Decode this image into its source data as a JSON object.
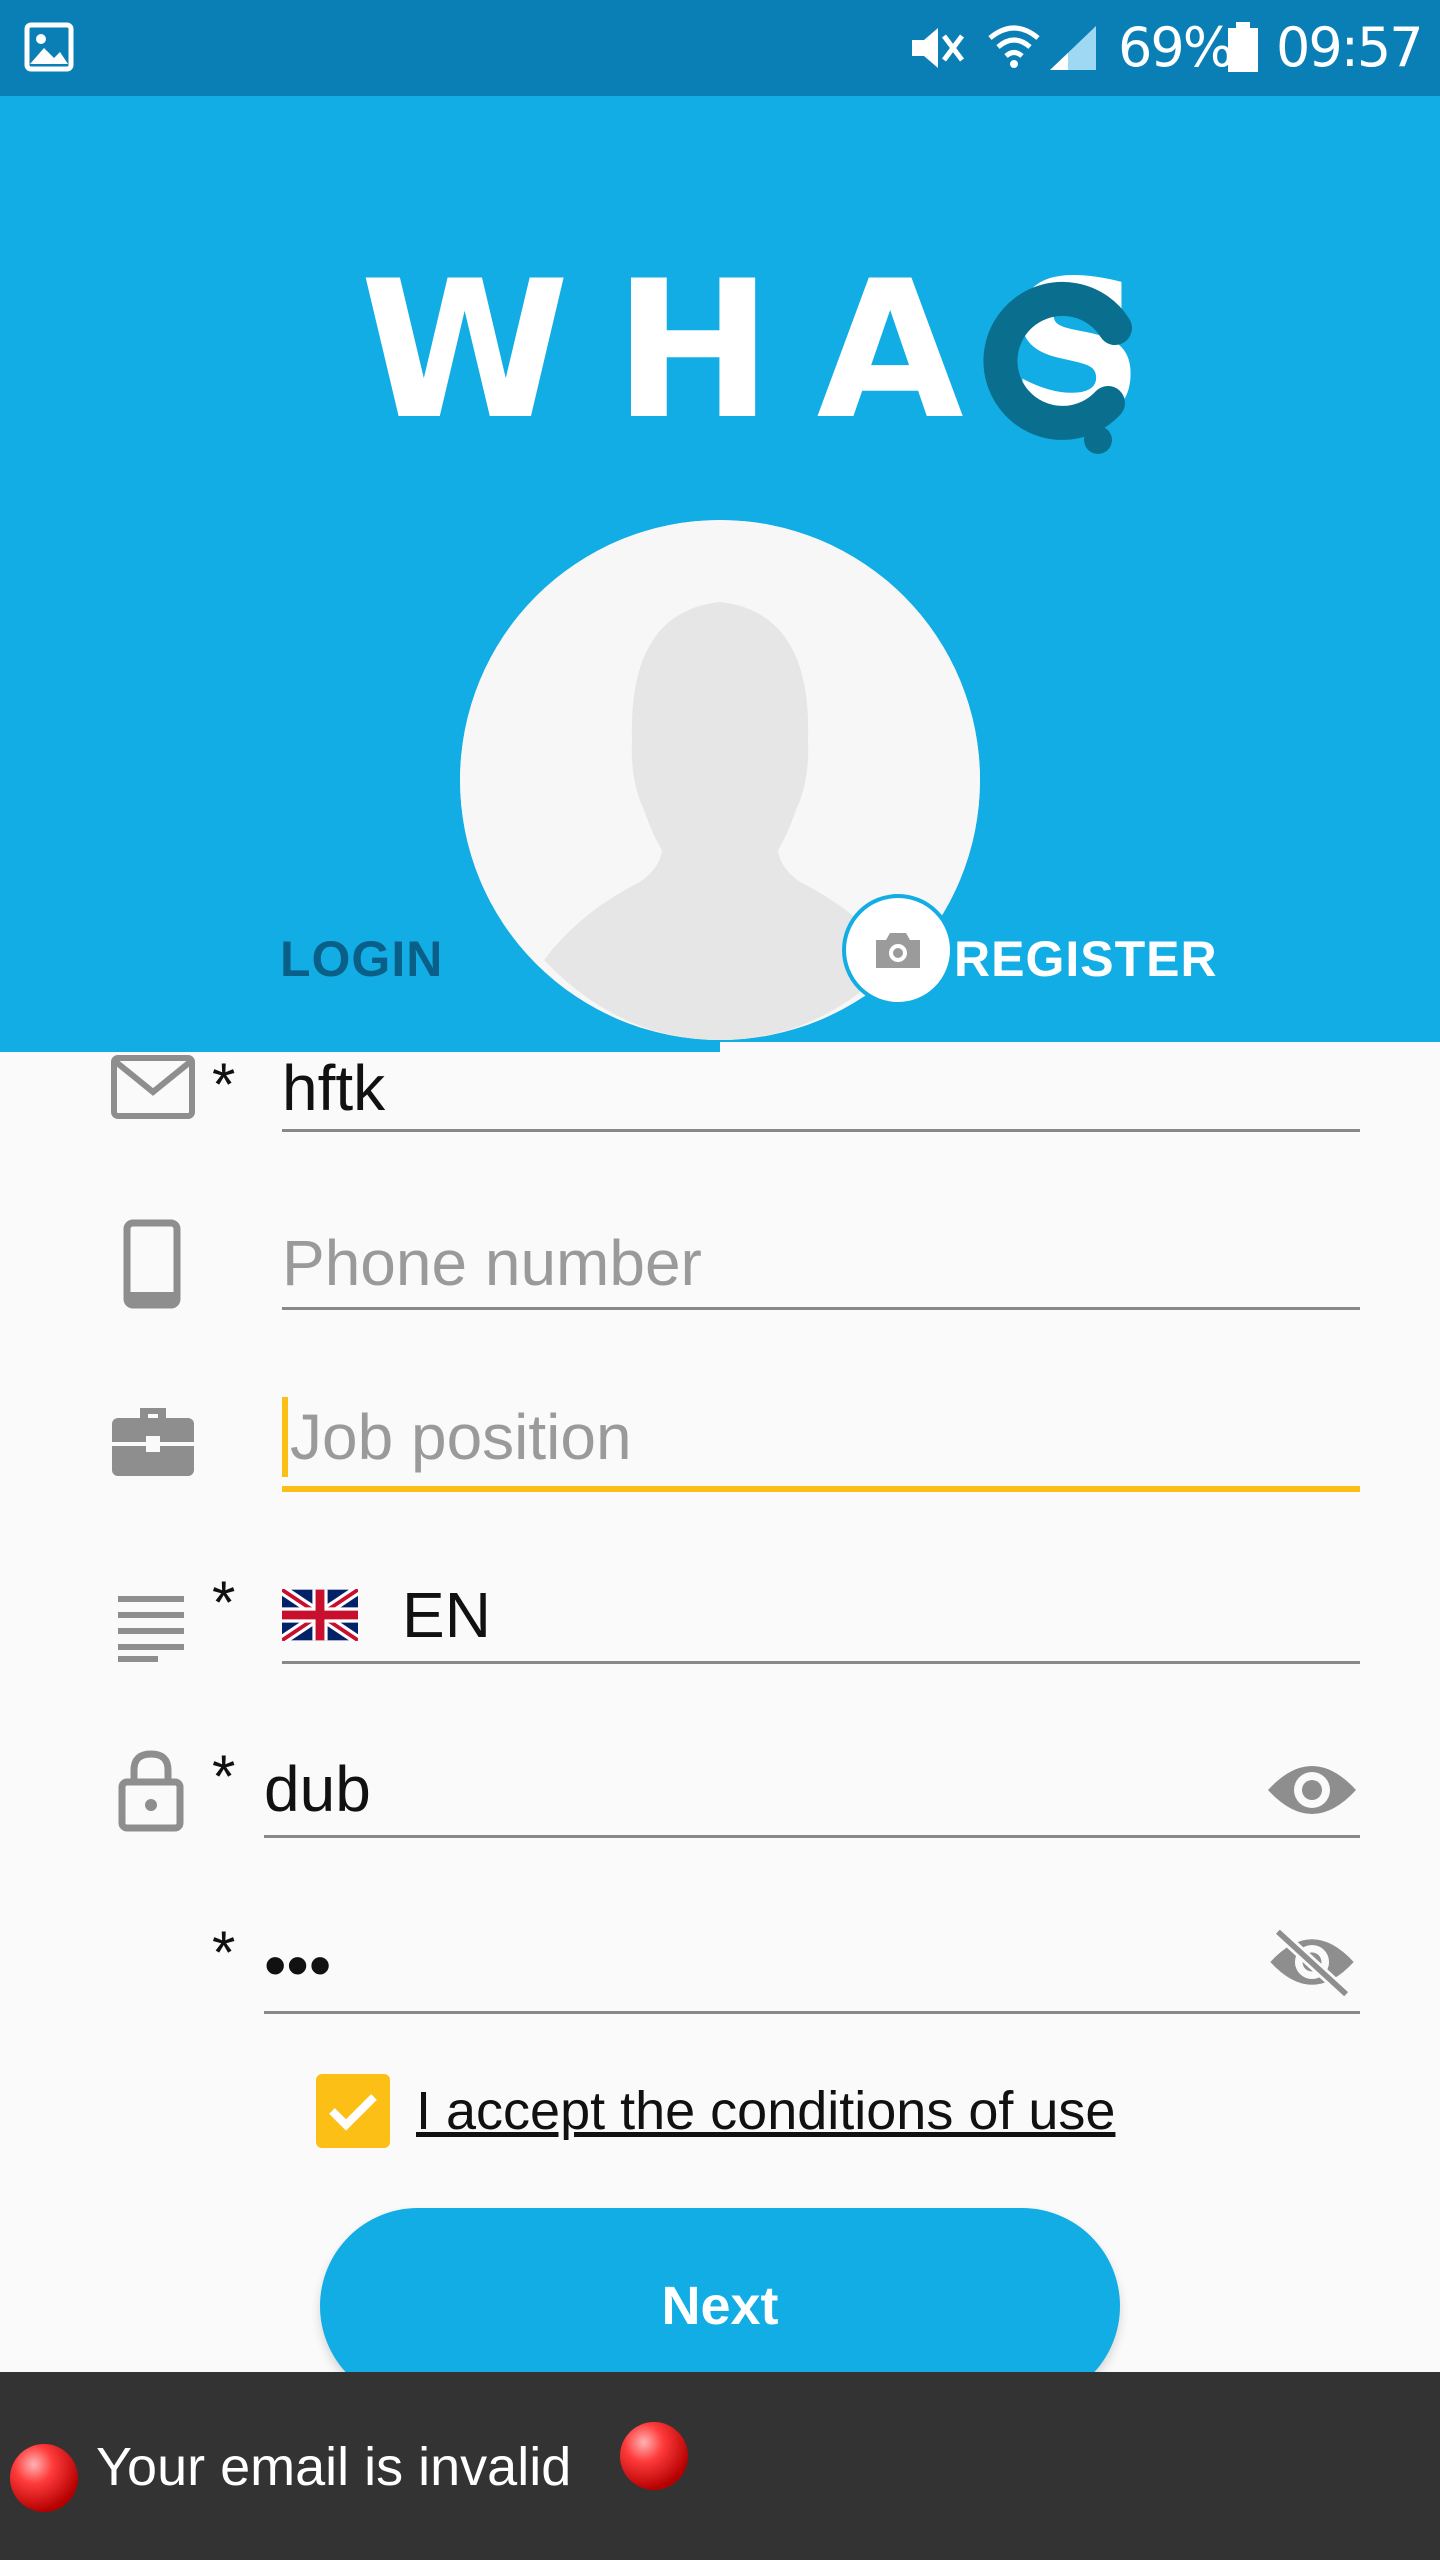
{
  "status_bar": {
    "battery": "69%",
    "time": "09:57",
    "icons": [
      "gallery-icon",
      "mute-icon",
      "wifi-icon",
      "signal-icon",
      "battery-icon"
    ]
  },
  "header": {
    "logo": "WHASQ",
    "logo_main": "WHAS",
    "brand_color": "#12ade4"
  },
  "tabs": [
    {
      "label": "LOGIN",
      "active": false
    },
    {
      "label": "REGISTER",
      "active": true
    }
  ],
  "form": {
    "email": {
      "value": "hftk",
      "required": "*",
      "icon": "email-icon"
    },
    "phone": {
      "placeholder": "Phone number",
      "icon": "phone-icon"
    },
    "job": {
      "placeholder": "Job position",
      "icon": "briefcase-icon",
      "focus_color": "#fbbf16"
    },
    "language": {
      "value": "EN",
      "required": "*",
      "icon": "language-icon"
    },
    "password": {
      "value": "dub",
      "required": "*",
      "icon": "lock-icon"
    },
    "password_confirm": {
      "value": "•••",
      "required": "*"
    },
    "accept_label": "I accept the conditions of use",
    "accept_checked": true,
    "next_label": "Next"
  },
  "toast": {
    "message": "Your email is invalid"
  }
}
